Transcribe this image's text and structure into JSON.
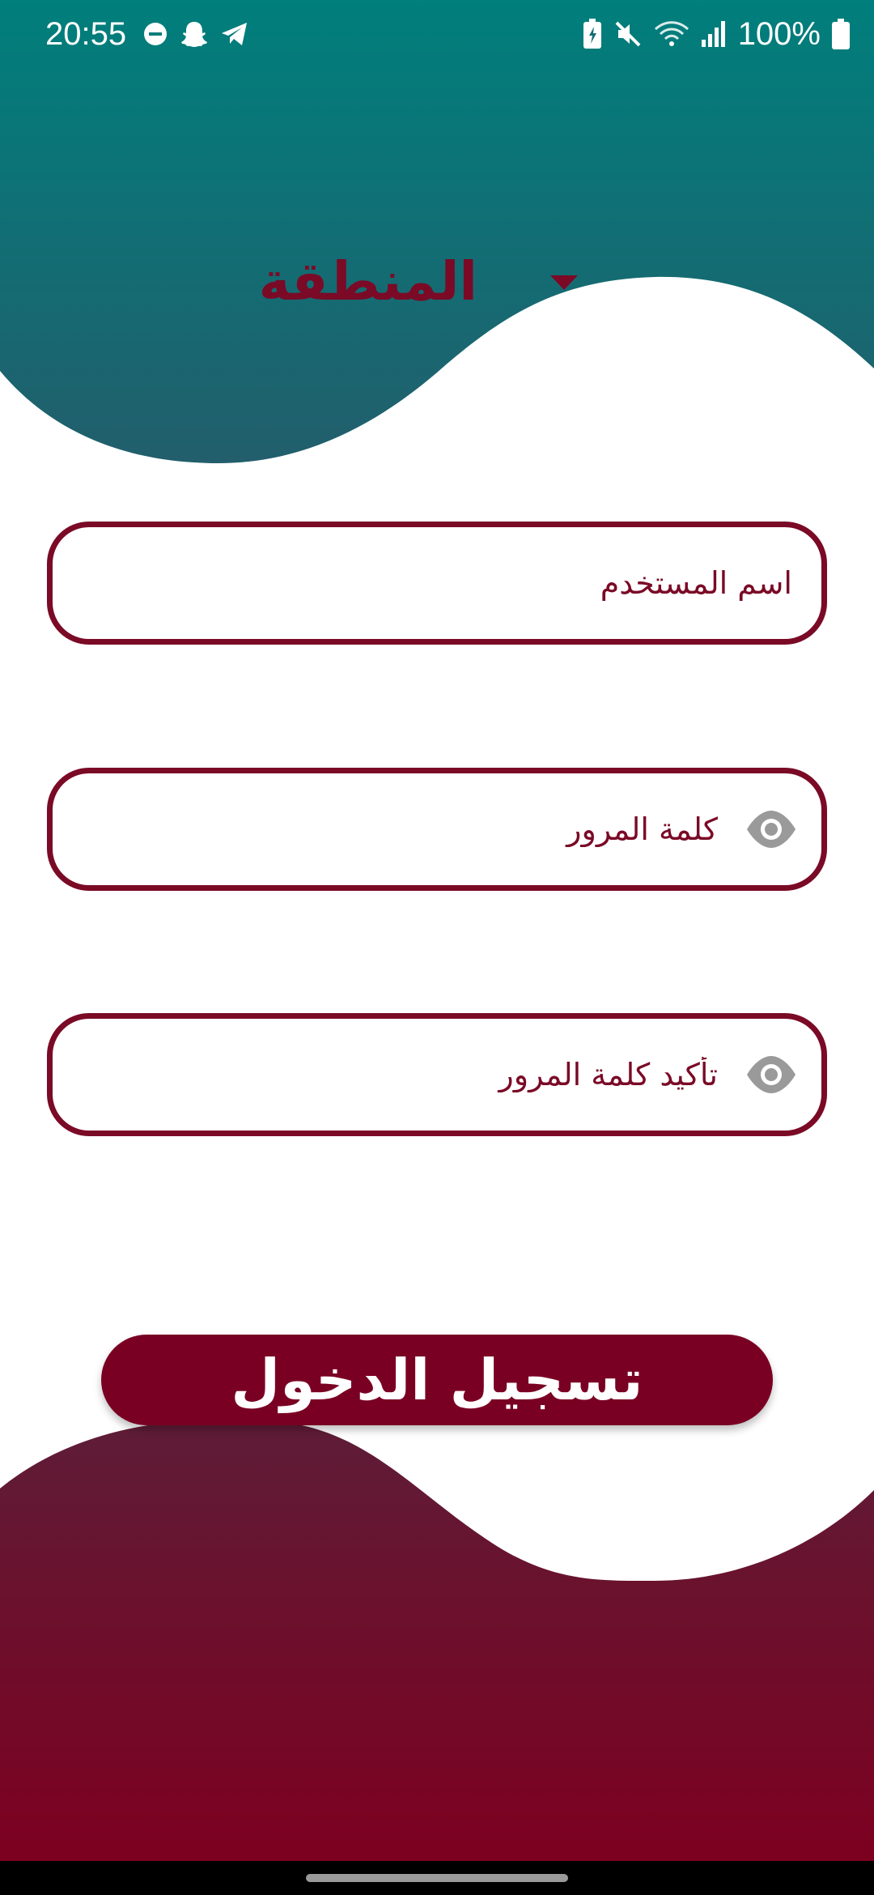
{
  "status_bar": {
    "time": "20:55",
    "battery_percent": "100%",
    "left_icons": [
      "do-not-disturb-icon",
      "snapchat-icon",
      "telegram-icon"
    ],
    "right_icons": [
      "battery-saver-icon",
      "mute-icon",
      "wifi-icon",
      "signal-icon",
      "battery-icon"
    ]
  },
  "region": {
    "label": "المنطقة",
    "icon": "dropdown-arrow-icon"
  },
  "form": {
    "username_placeholder": "اسم المستخدم",
    "password_placeholder": "كلمة المرور",
    "confirm_password_placeholder": "تأكيد كلمة المرور",
    "visibility_icon": "eye-icon"
  },
  "login_button": {
    "label": "تسجيل الدخول"
  },
  "colors": {
    "accent": "#7a0a26",
    "top_gradient_start": "#007f7c",
    "top_gradient_end": "#225e6c",
    "bottom_gradient_start": "#5e1d37",
    "bottom_gradient_end": "#7d0020"
  }
}
